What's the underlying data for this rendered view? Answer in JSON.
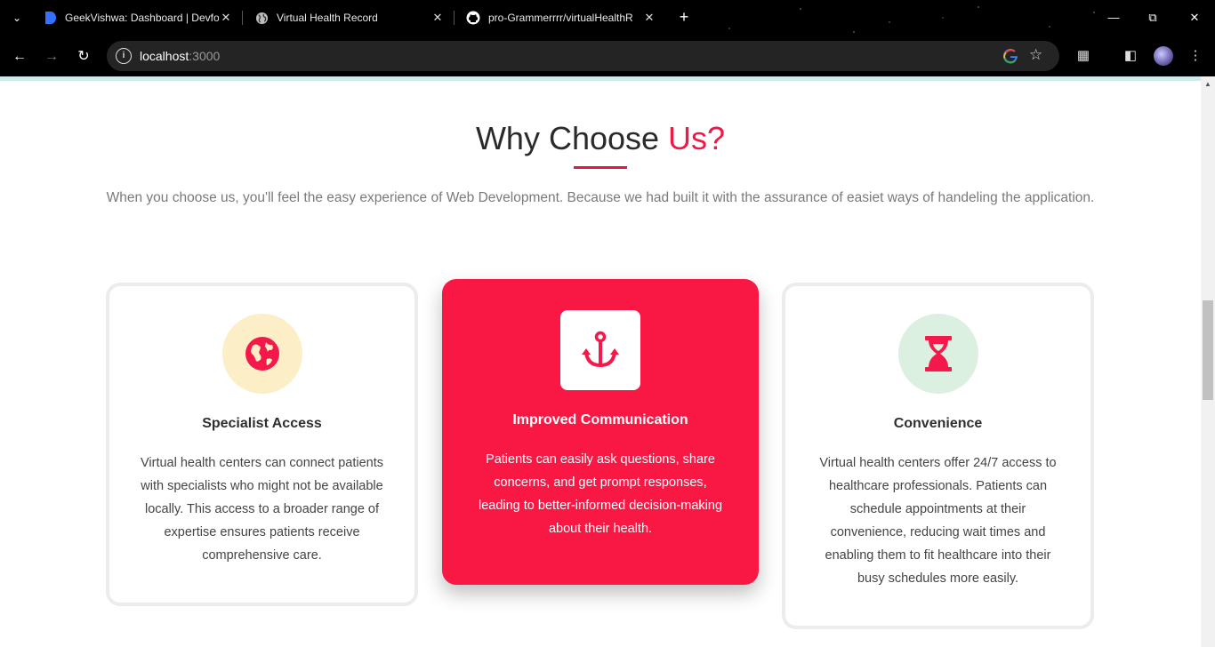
{
  "browser": {
    "tabs": [
      {
        "title": "GeekVishwa: Dashboard | Devfo",
        "favicon": "devfolio-icon"
      },
      {
        "title": "Virtual Health Record",
        "favicon": "globe-icon"
      },
      {
        "title": "pro-Grammerrrr/virtualHealthR",
        "favicon": "github-icon"
      }
    ],
    "url_host": "localhost",
    "url_port": ":3000"
  },
  "section": {
    "title_main": "Why Choose ",
    "title_highlight": "Us?",
    "description": "When you choose us, you'll feel the easy experience of Web Development. Because we had built it with the assurance of easiet ways of handeling the application."
  },
  "cards": [
    {
      "icon": "globe-icon",
      "title": "Specialist Access",
      "body": "Virtual health centers can connect patients with specialists who might not be available locally. This access to a broader range of expertise ensures patients receive comprehensive care."
    },
    {
      "icon": "anchor-icon",
      "title": "Improved Communication",
      "body": "Patients can easily ask questions, share concerns, and get prompt responses, leading to better-informed decision-making about their health."
    },
    {
      "icon": "hourglass-icon",
      "title": "Convenience",
      "body": "Virtual health centers offer 24/7 access to healthcare professionals. Patients can schedule appointments at their convenience, reducing wait times and enabling them to fit healthcare into their busy schedules more easily."
    }
  ],
  "colors": {
    "accent": "#f91844",
    "card1_icon_bg": "#fcefc7",
    "card3_icon_bg": "#dcf0e1"
  }
}
